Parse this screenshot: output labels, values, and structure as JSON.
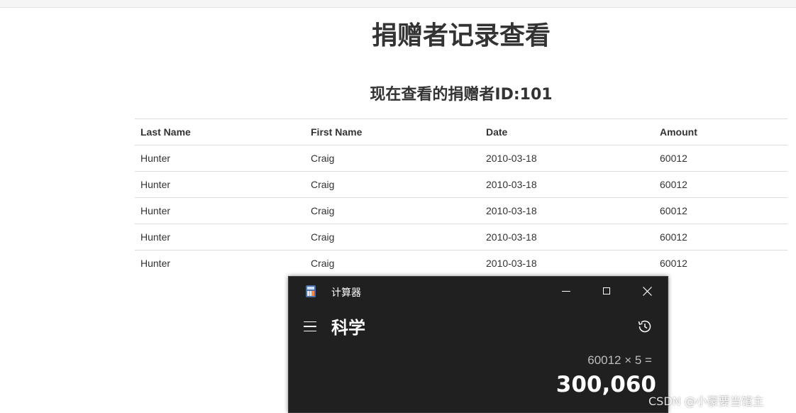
{
  "page": {
    "title": "捐赠者记录查看",
    "subtitle": "现在查看的捐赠者ID:101"
  },
  "table": {
    "headers": [
      "Last Name",
      "First Name",
      "Date",
      "Amount"
    ],
    "rows": [
      [
        "Hunter",
        "Craig",
        "2010-03-18",
        "60012"
      ],
      [
        "Hunter",
        "Craig",
        "2010-03-18",
        "60012"
      ],
      [
        "Hunter",
        "Craig",
        "2010-03-18",
        "60012"
      ],
      [
        "Hunter",
        "Craig",
        "2010-03-18",
        "60012"
      ],
      [
        "Hunter",
        "Craig",
        "2010-03-18",
        "60012"
      ]
    ]
  },
  "calculator": {
    "window_title": "计算器",
    "mode": "科学",
    "expression": "60012 × 5 =",
    "result": "300,060",
    "icons": {
      "app": "calculator-icon",
      "minimize": "minimize-icon",
      "maximize": "maximize-icon",
      "close": "close-icon",
      "menu": "hamburger-menu-icon",
      "history": "history-icon"
    }
  },
  "watermark": "CSDN @小豪要当馆主",
  "colors": {
    "calculator_bg": "#202020",
    "text": "#333333",
    "border": "#dddddd"
  }
}
